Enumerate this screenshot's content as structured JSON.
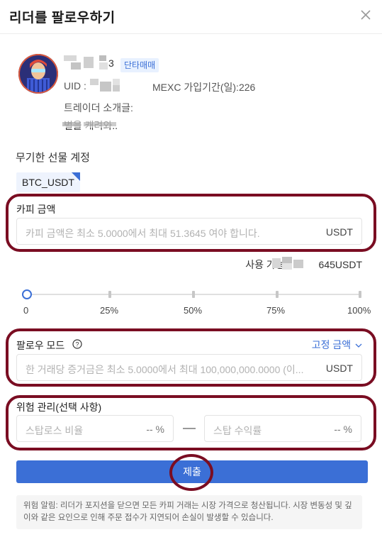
{
  "header": {
    "title": "리더를 팔로우하기",
    "close_icon": "close-icon"
  },
  "trader": {
    "name_suffix": "3",
    "badge": "단타매매",
    "uid_label": "UID :",
    "joined": "MEXC 가입기간(일):226",
    "intro_label": "트레이더 소개글:",
    "intro_text": "별을 캐려와.."
  },
  "account": {
    "label": "무기한 선물 계정",
    "pair": "BTC_USDT"
  },
  "copy_amount": {
    "label": "카피 금액",
    "placeholder": "카피 금액은 최소 5.0000에서 최대 51.3645 여야 합니다.",
    "unit": "USDT"
  },
  "available": {
    "text": "사용 가능:",
    "value_tail": "645USDT"
  },
  "slider": {
    "labels": [
      "0",
      "25%",
      "50%",
      "75%",
      "100%"
    ],
    "value_fraction": 0
  },
  "follow_mode": {
    "label": "팔로우 모드",
    "mode": "고정 금액",
    "placeholder": "한 거래당 증거금은 최소 5.0000에서 최대 100,000,000.0000 (이...",
    "unit": "USDT"
  },
  "risk": {
    "label": "위험 관리(선택 사항)",
    "stop_loss_placeholder": "스탑로스 비율",
    "take_profit_placeholder": "스탑 수익률",
    "stop_loss_unit": "-- %",
    "take_profit_unit": "-- %"
  },
  "submit_label": "제출",
  "notice": "위험 알림: 리더가 포지션을 닫으면 모든 카피 거래는 시장 가격으로 청산됩니다. 시장 변동성 및 깊이와 같은 요인으로 인해 주문 접수가 지연되어 손실이 발생할 수 있습니다.",
  "colors": {
    "accent": "#3b6fd6",
    "highlight_ring": "#7a0d22"
  }
}
